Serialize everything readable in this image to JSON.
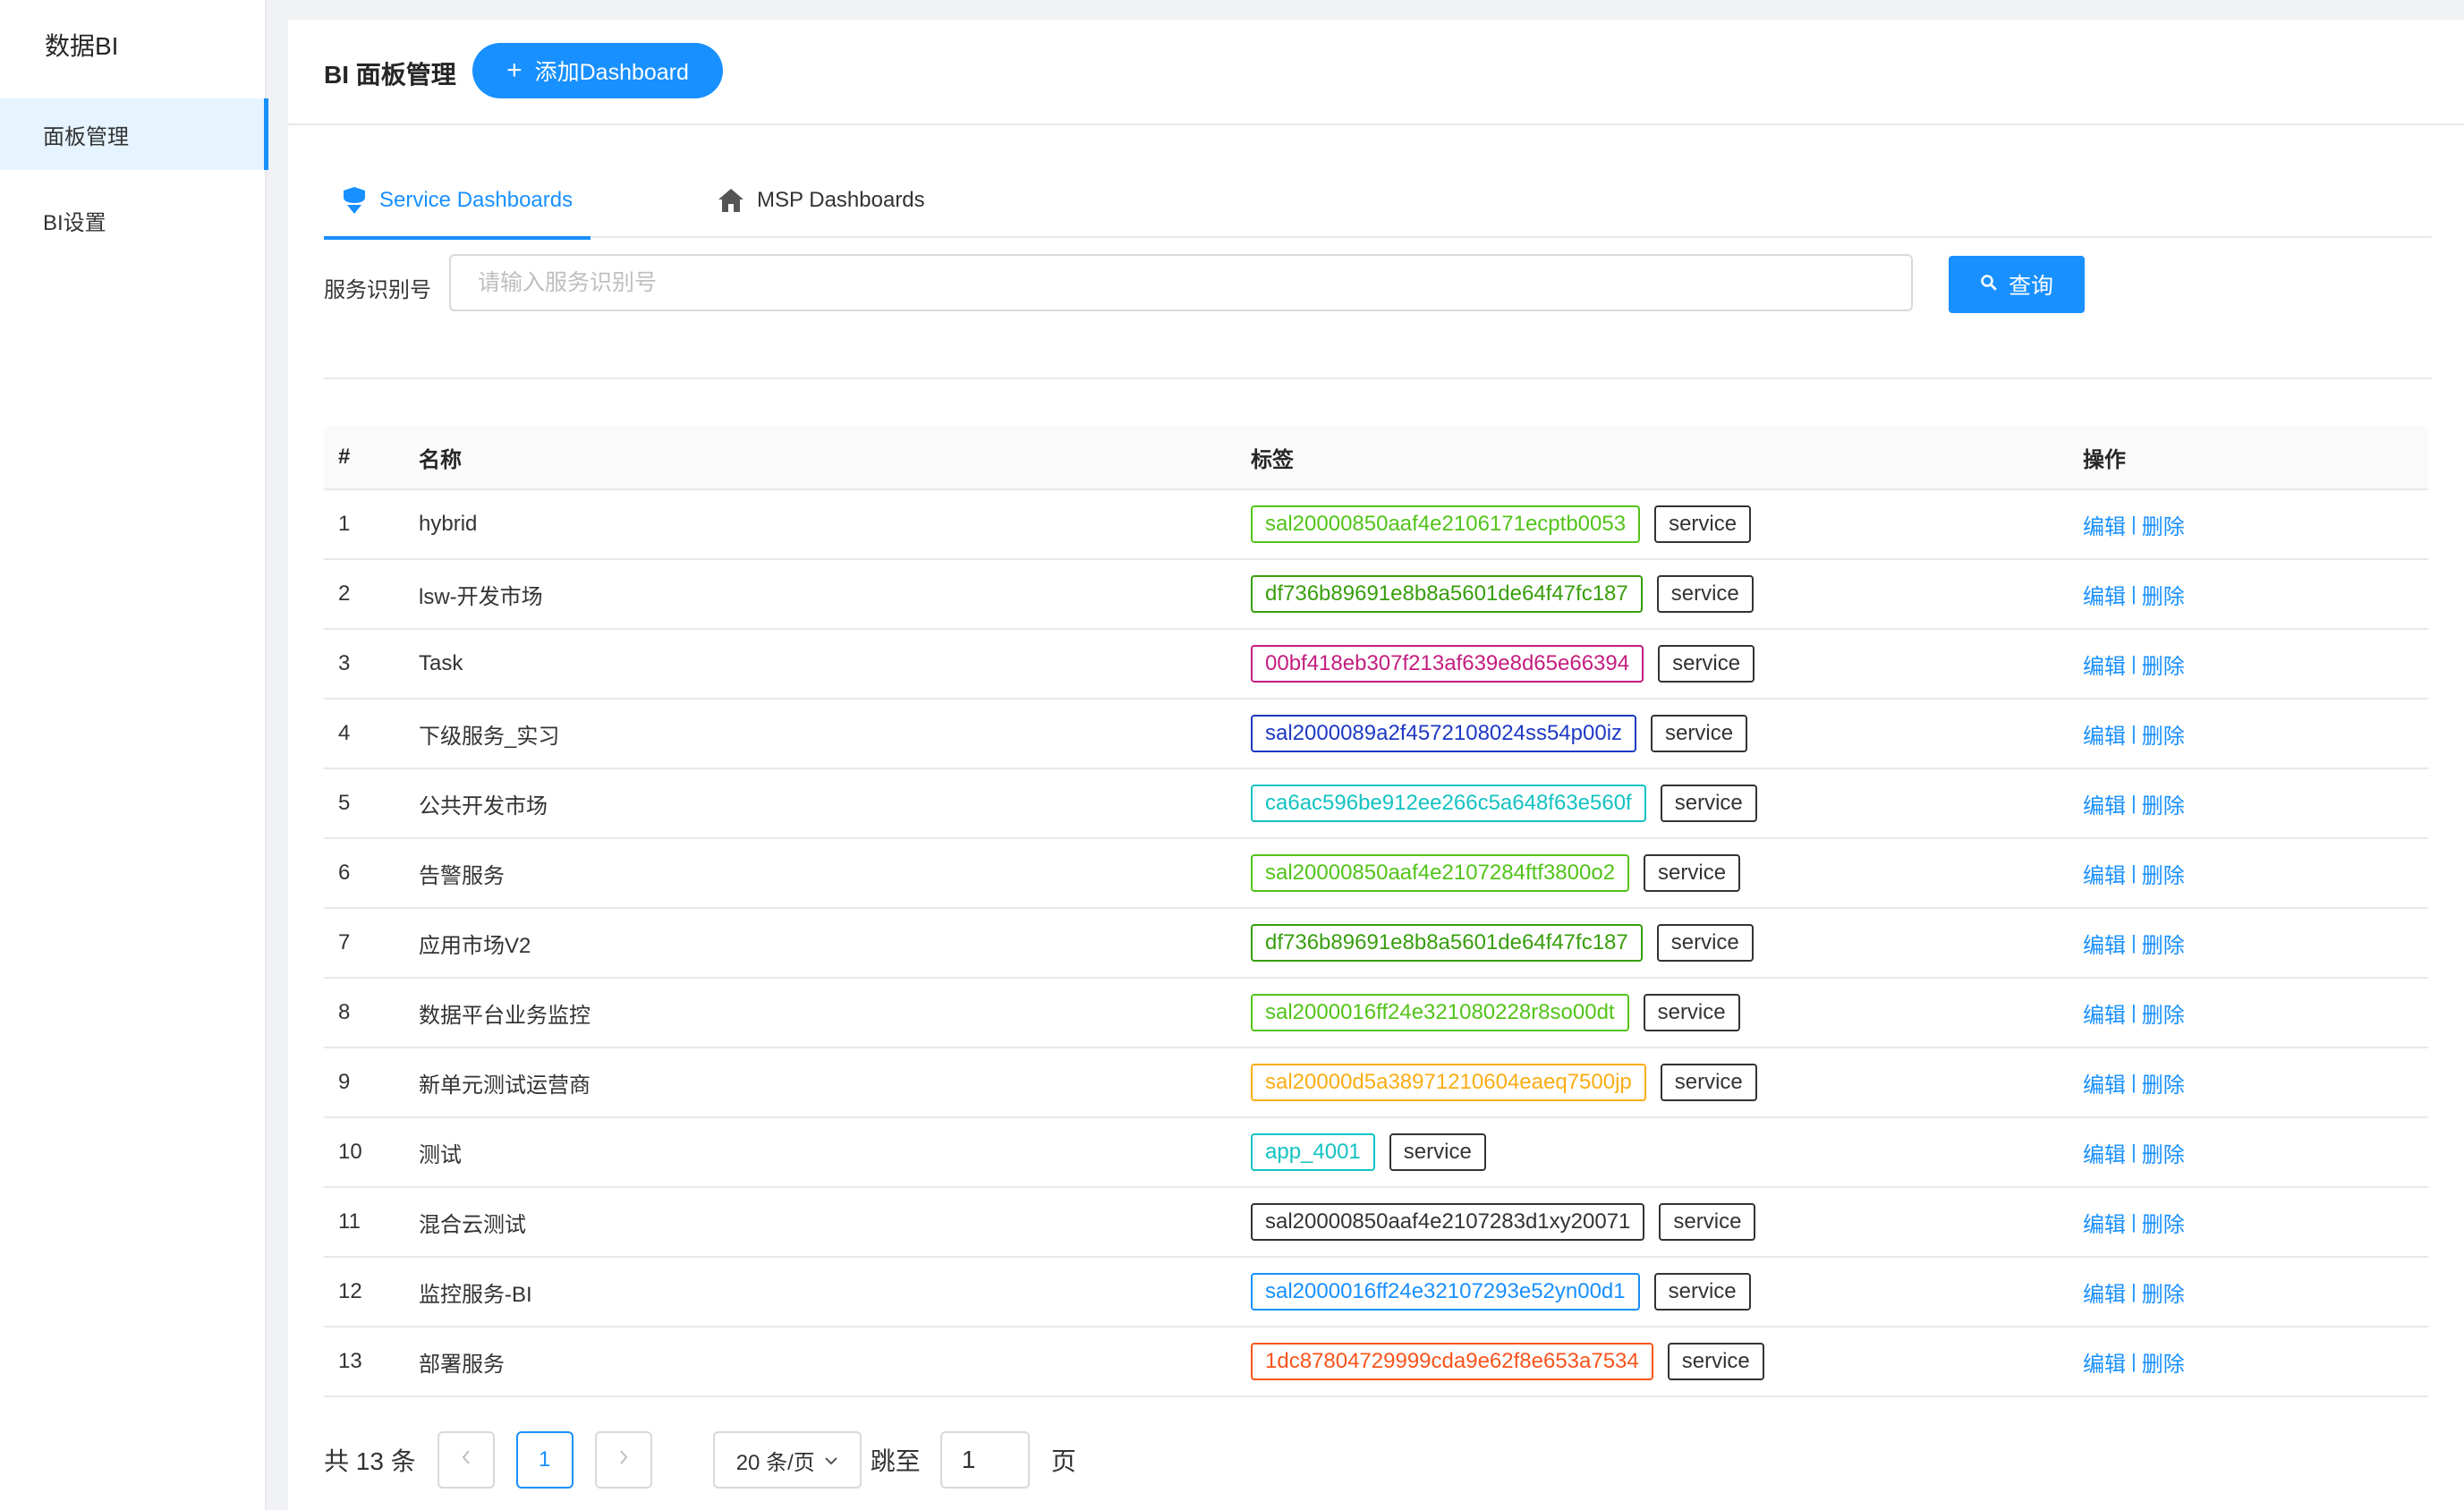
{
  "sidebar": {
    "brand": "数据BI",
    "items": [
      {
        "label": "面板管理",
        "active": true
      },
      {
        "label": "BI设置",
        "active": false
      }
    ]
  },
  "header": {
    "title": "BI 面板管理",
    "add_button_label": "添加Dashboard"
  },
  "tabs": [
    {
      "label": "Service Dashboards",
      "icon": "shield-icon",
      "active": true
    },
    {
      "label": "MSP Dashboards",
      "icon": "home-icon",
      "active": false
    }
  ],
  "filter": {
    "label": "服务识别号",
    "placeholder": "请输入服务识别号",
    "value": "",
    "query_label": "查询"
  },
  "table": {
    "columns": [
      "#",
      "名称",
      "标签",
      "操作"
    ],
    "edit_label": "编辑",
    "sep": "|",
    "delete_label": "删除",
    "rows": [
      {
        "idx": "1",
        "name": "hybrid",
        "tag": "sal20000850aaf4e2106171ecptb0053",
        "tag_color": "#52c41a",
        "tag2": "service"
      },
      {
        "idx": "2",
        "name": "lsw-开发市场",
        "tag": "df736b89691e8b8a5601de64f47fc187",
        "tag_color": "#389e0d",
        "tag2": "service"
      },
      {
        "idx": "3",
        "name": "Task",
        "tag": "00bf418eb307f213af639e8d65e66394",
        "tag_color": "#c41d7f",
        "tag2": "service"
      },
      {
        "idx": "4",
        "name": "下级服务_实习",
        "tag": "sal2000089a2f4572108024ss54p00iz",
        "tag_color": "#1d39c4",
        "tag2": "service"
      },
      {
        "idx": "5",
        "name": "公共开发市场",
        "tag": "ca6ac596be912ee266c5a648f63e560f",
        "tag_color": "#13c2c2",
        "tag2": "service"
      },
      {
        "idx": "6",
        "name": "告警服务",
        "tag": "sal20000850aaf4e2107284ftf3800o2",
        "tag_color": "#52c41a",
        "tag2": "service"
      },
      {
        "idx": "7",
        "name": "应用市场V2",
        "tag": "df736b89691e8b8a5601de64f47fc187",
        "tag_color": "#389e0d",
        "tag2": "service"
      },
      {
        "idx": "8",
        "name": "数据平台业务监控",
        "tag": "sal2000016ff24e321080228r8so00dt",
        "tag_color": "#52c41a",
        "tag2": "service"
      },
      {
        "idx": "9",
        "name": "新单元测试运营商",
        "tag": "sal20000d5a38971210604eaeq7500jp",
        "tag_color": "#faad14",
        "tag2": "service"
      },
      {
        "idx": "10",
        "name": "测试",
        "tag": "app_4001",
        "tag_color": "#13c2c2",
        "tag2": "service"
      },
      {
        "idx": "11",
        "name": "混合云测试",
        "tag": "sal20000850aaf4e2107283d1xy20071",
        "tag_color": "#333333",
        "tag2": "service"
      },
      {
        "idx": "12",
        "name": "监控服务-BI",
        "tag": "sal2000016ff24e32107293e52yn00d1",
        "tag_color": "#1890ff",
        "tag2": "service"
      },
      {
        "idx": "13",
        "name": "部署服务",
        "tag": "1dc87804729999cda9e62f8e653a7534",
        "tag_color": "#fa541c",
        "tag2": "service"
      }
    ]
  },
  "pagination": {
    "total_text": "共 13 条",
    "current_page": "1",
    "prev_icon": "chevron-left-icon",
    "next_icon": "chevron-right-icon",
    "page_size": "20 条/页",
    "jump_label": "跳至",
    "jump_value": "1",
    "page_suffix": "页"
  },
  "colors": {
    "primary": "#1890ff",
    "sidebar_active_bg": "#e6f4ff",
    "border": "#e8e8e8"
  }
}
